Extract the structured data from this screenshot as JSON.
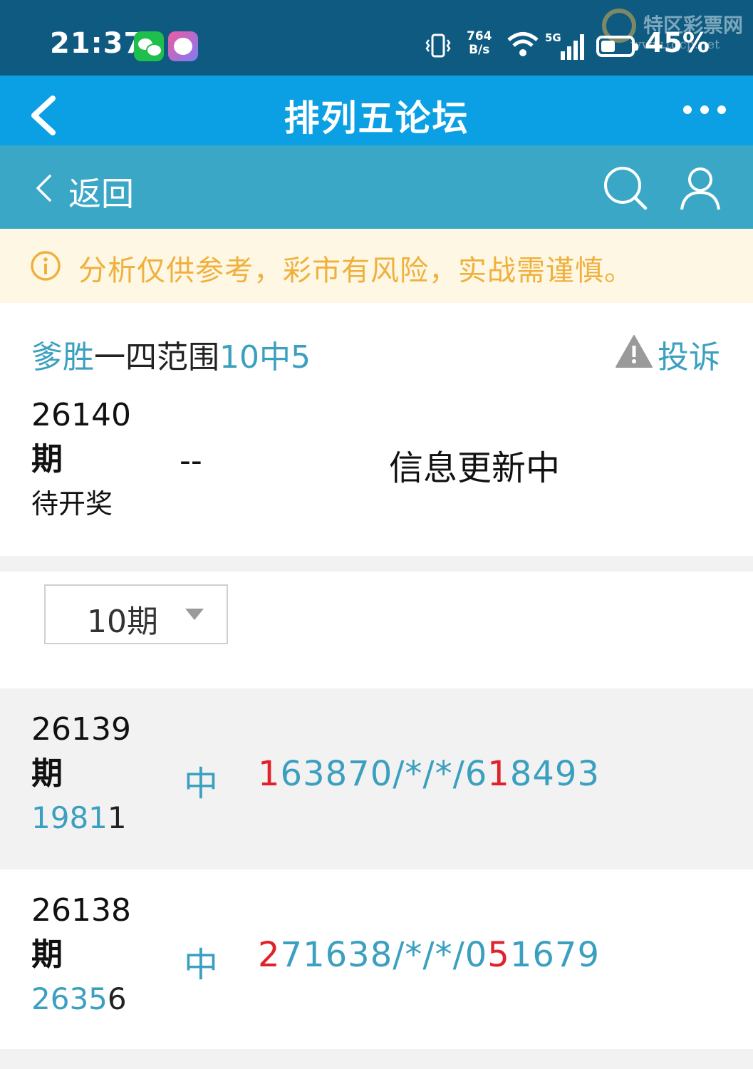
{
  "status_bar": {
    "time": "21:37",
    "net_speed_top": "764",
    "net_speed_bottom": "B/s",
    "network": "5G",
    "battery": "45%",
    "icons": [
      "wechat-icon",
      "app-face-icon",
      "vibrate-icon",
      "wifi-icon",
      "signal-icon",
      "battery-icon"
    ],
    "watermark": {
      "text": "特区彩票网",
      "url": "www.tqcp.net"
    }
  },
  "title_bar": {
    "title": "排列五论坛",
    "icons": [
      "back-chevron-icon",
      "more-icon"
    ]
  },
  "sub_nav": {
    "back_label": "返回",
    "icons": [
      "search-icon",
      "user-icon"
    ]
  },
  "notice": {
    "text": "分析仅供参考，彩市有风险，实战需谨慎。",
    "color": "#f0b03d"
  },
  "post": {
    "title_author": "爹胜",
    "title_main": "一四范围",
    "title_tail": "10中5",
    "complain_label": "投诉",
    "current": {
      "period_number": "26140",
      "period_suffix": "期",
      "status": "待开奖",
      "dash": "--",
      "info": "信息更新中"
    }
  },
  "filter": {
    "selected": "10期"
  },
  "rows": [
    {
      "period_number": "26139",
      "period_suffix": "期",
      "result_prefix": "1981",
      "result_hit": "1",
      "zhong": "中",
      "pred": [
        "1",
        "63870/*/*/6",
        "1",
        "8493"
      ]
    },
    {
      "period_number": "26138",
      "period_suffix": "期",
      "result_prefix": "2635",
      "result_hit": "6",
      "zhong": "中",
      "pred": [
        "2",
        "71638/*/*/0",
        "5",
        "1679"
      ]
    }
  ],
  "colors": {
    "status_bar": "#0f5a80",
    "title_bar": "#0ba0e3",
    "sub_nav": "#3aa7c7",
    "accent_teal": "#3ba0c0",
    "hit_red": "#e0222a"
  }
}
